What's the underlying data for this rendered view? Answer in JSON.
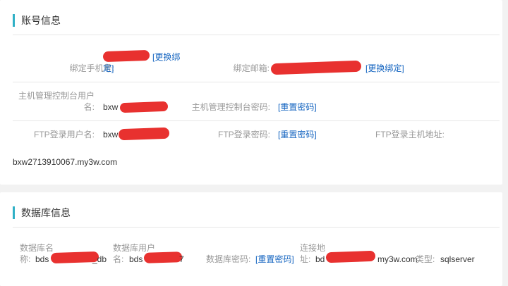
{
  "account": {
    "title": "账号信息",
    "bind_phone_label": "绑定手机号:",
    "bind_phone_link_line1": "[更换绑",
    "bind_phone_link_line2": "定]",
    "bind_email_label": "绑定邮箱:",
    "bind_email_link": "[更换绑定]",
    "host_user_label_line1": "主机管理控制台用户",
    "host_user_label_line2": "名:",
    "host_user_value": "bxw",
    "host_pwd_label": "主机管理控制台密码:",
    "host_pwd_link": "[重置密码]",
    "ftp_user_label": "FTP登录用户名:",
    "ftp_user_value": "bxw",
    "ftp_pwd_label": "FTP登录密码:",
    "ftp_pwd_link": "[重置密码]",
    "ftp_host_label": "FTP登录主机地址:",
    "ftp_host_value": "bxw2713910067.my3w.com"
  },
  "database": {
    "title": "数据库信息",
    "db_name_label_line1": "数据库名",
    "db_name_label_line2": "称:",
    "db_name_value_prefix": "bds",
    "db_name_value_suffix": "_db",
    "db_user_label_line1": "数据库用户",
    "db_user_label_line2": "名:",
    "db_user_value_prefix": "bds",
    "db_user_value_suffix": "7",
    "db_pwd_label": "数据库密码:",
    "db_pwd_link": "[重置密码]",
    "conn_label_line1": "连接地",
    "conn_label_line2": "址:",
    "conn_value_prefix": "bd",
    "conn_value_suffix": "my3w.com",
    "type_label": "类型:",
    "type_value": "sqlserver"
  },
  "colors": {
    "accent": "#2fb0c6",
    "link": "#1565c0",
    "redaction": "#e8312f"
  }
}
